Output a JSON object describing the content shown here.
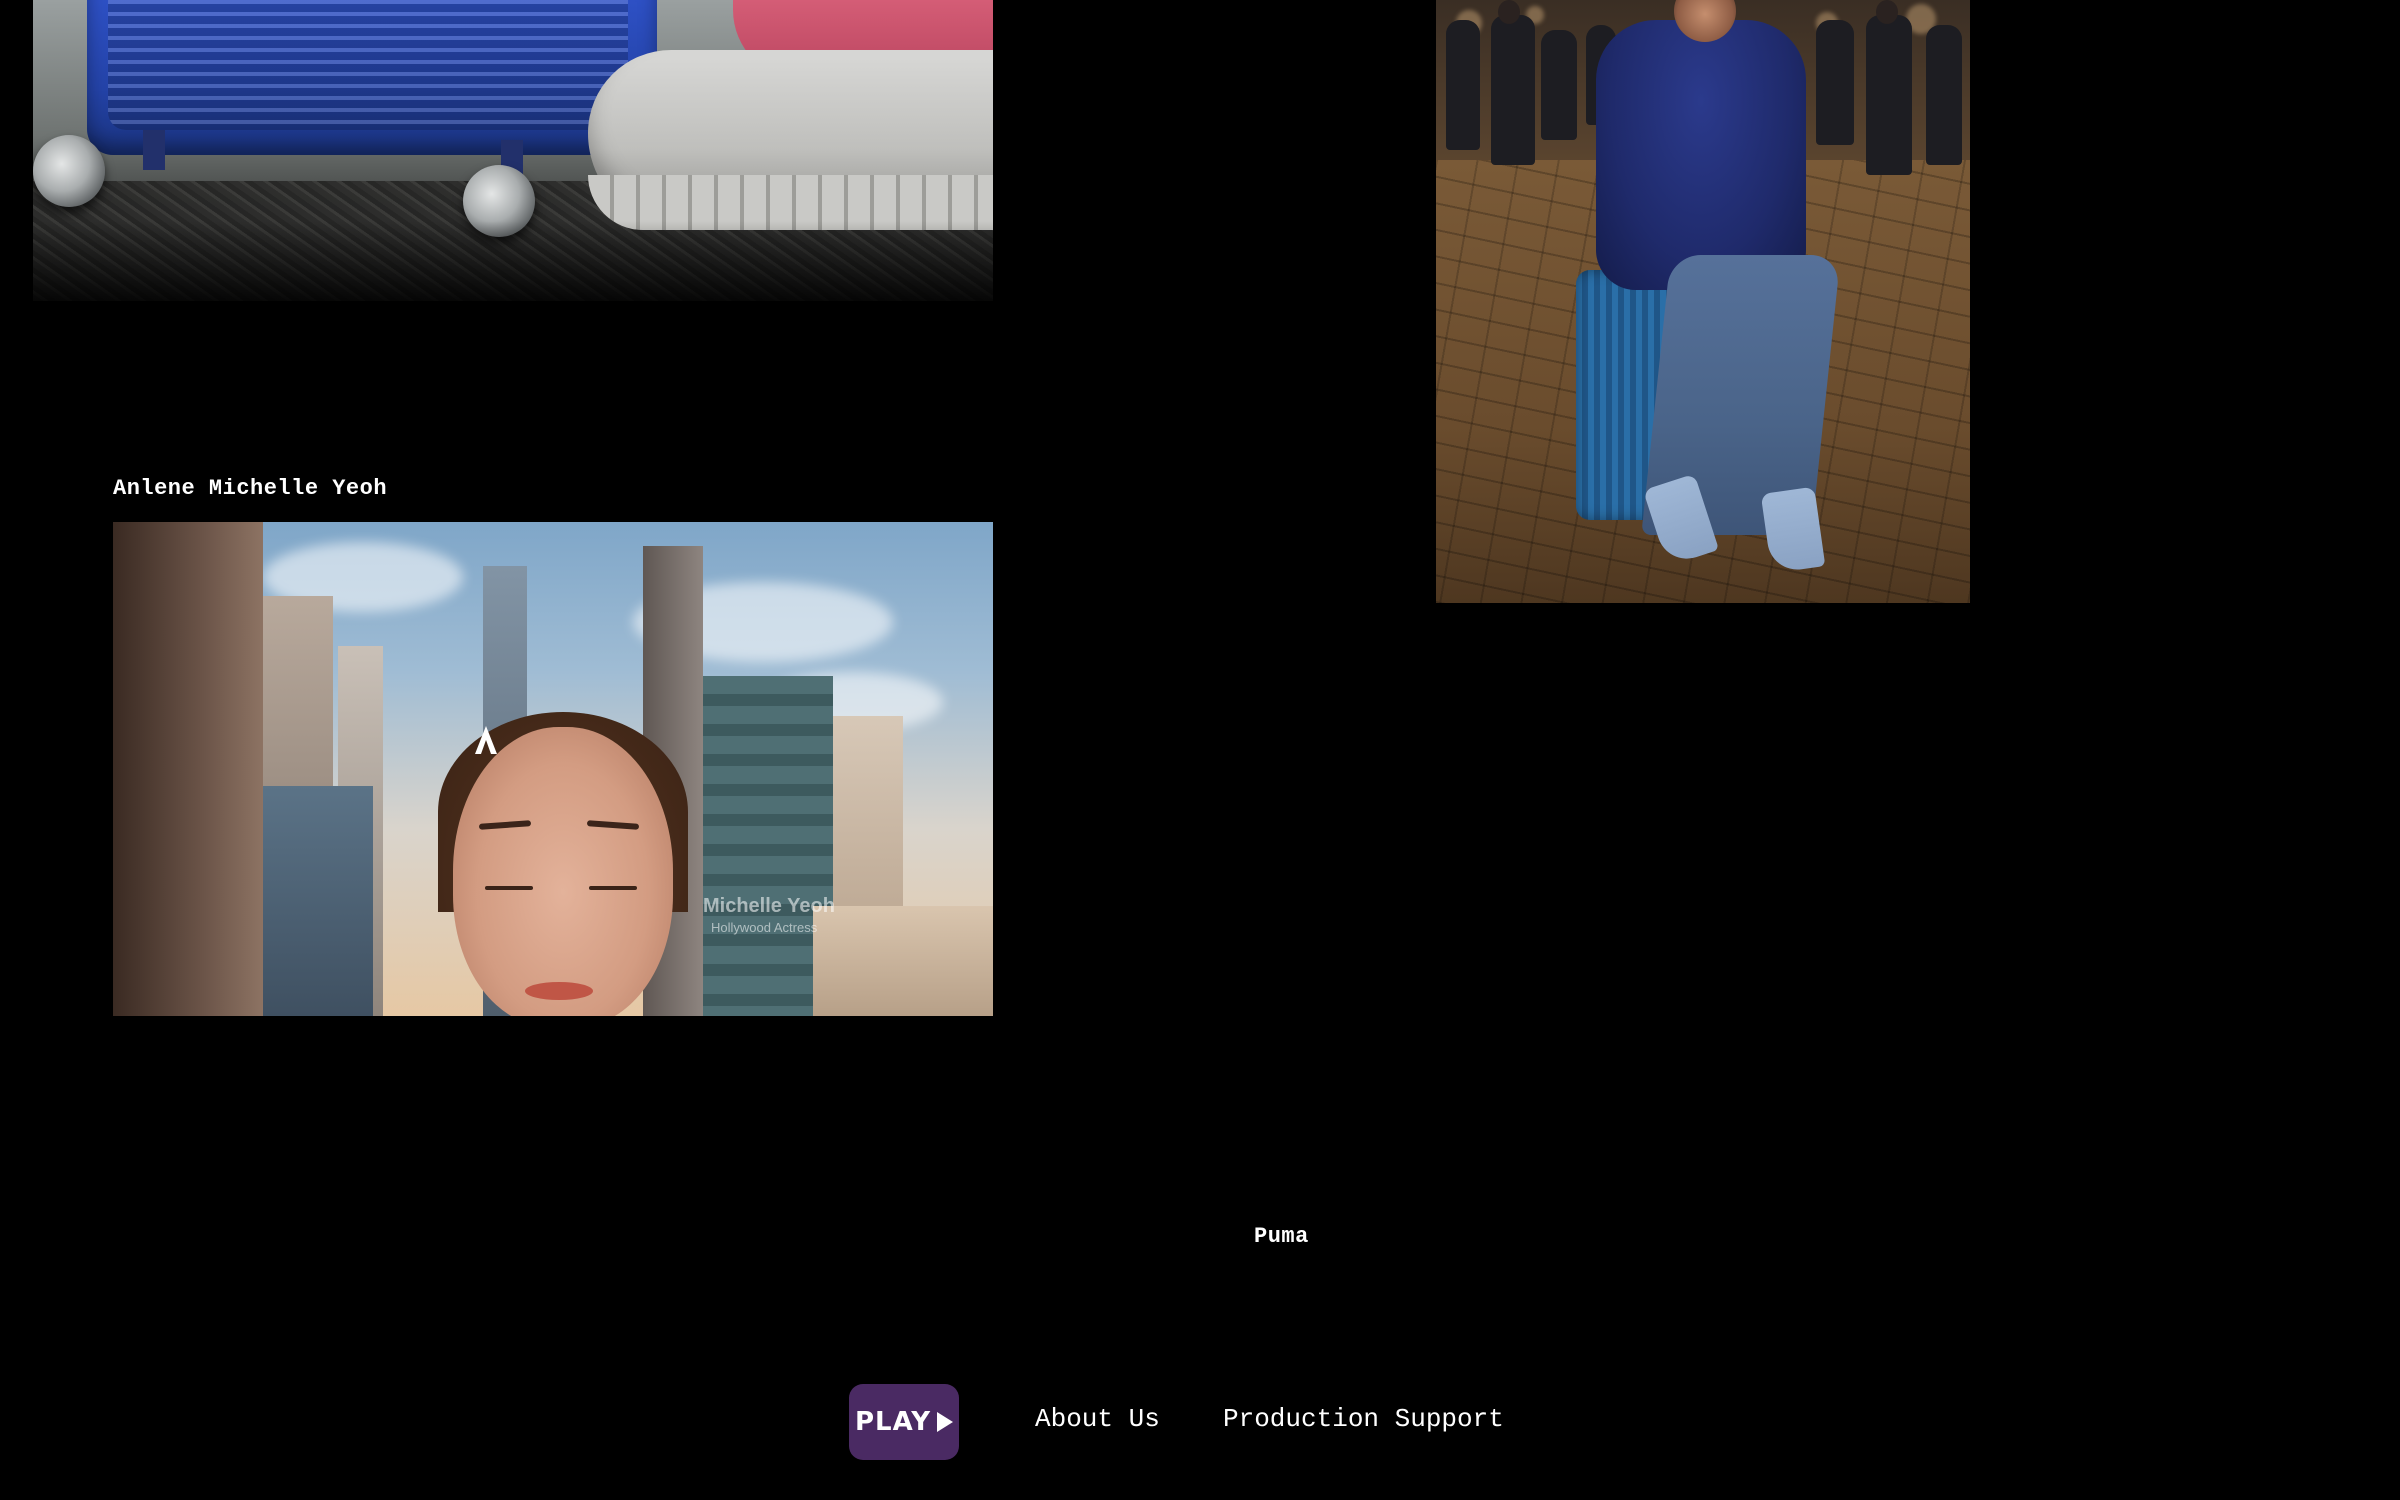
{
  "projects": [
    {
      "caption": ""
    },
    {
      "caption": ""
    },
    {
      "caption": "Anlene Michelle Yeoh",
      "watermark_name": "Michelle Yeoh",
      "watermark_sub": "Hollywood Actress"
    },
    {
      "caption": "Puma"
    }
  ],
  "footer": {
    "logo_text": "PLAY",
    "nav": [
      {
        "label": "About Us"
      },
      {
        "label": "Production Support"
      }
    ]
  },
  "colors": {
    "background": "#000000",
    "text": "#ffffff",
    "logo_bg": "#4a2a63"
  },
  "icons": {
    "logo_play": "play-triangle-icon",
    "brand_mark": "anlene-logo-icon"
  }
}
